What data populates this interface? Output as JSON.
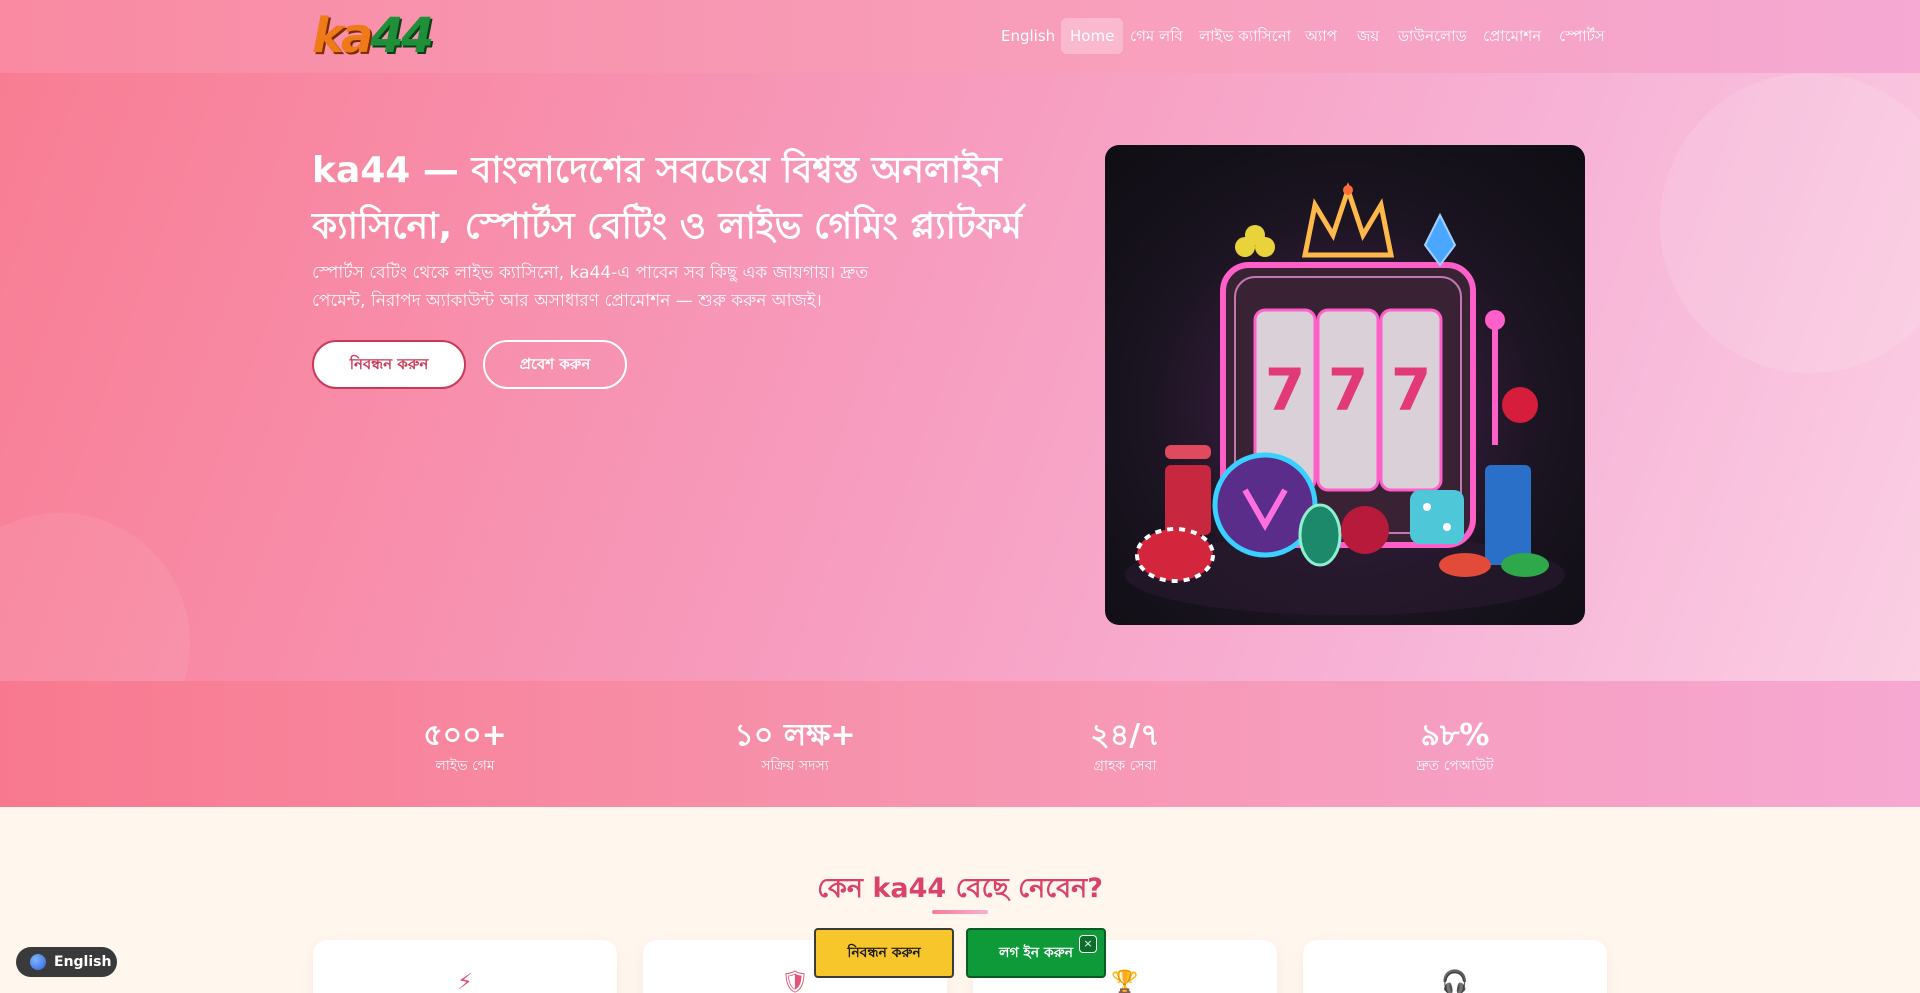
{
  "header": {
    "logo_text_left": "ka",
    "logo_text_right": "44",
    "nav": [
      {
        "label": "English"
      },
      {
        "label": "Home",
        "active": true
      },
      {
        "label": "গেম লবি"
      },
      {
        "label": "লাইভ ক্যাসিনো"
      },
      {
        "label": "অ্যাপ"
      },
      {
        "label": "জয়"
      },
      {
        "label": "ডাউনলোড"
      },
      {
        "label": "প্রোমোশন"
      },
      {
        "label": "স্পোর্টস"
      }
    ]
  },
  "hero": {
    "title": "ka44 — বাংলাদেশের সবচেয়ে বিশ্বস্ত অনলাইন ক্যাসিনো, স্পোর্টস বেটিং ও লাইভ গেমিং প্ল্যাটফর্ম",
    "subtitle": "স্পোর্টস বেটিং থেকে লাইভ ক্যাসিনো, ka44-এ পাবেন সব কিছু এক জায়গায়। দ্রুত পেমেন্ট, নিরাপদ অ্যাকাউন্ট আর অসাধারণ প্রোমোশন — শুরু করুন আজই।",
    "register_button": "নিবন্ধন করুন",
    "login_button": "প্রবেশ করুন",
    "image_icon": "slot-machine-image"
  },
  "stats": [
    {
      "value": "৫০০+",
      "label": "লাইভ গেম"
    },
    {
      "value": "১০ লক্ষ+",
      "label": "সক্রিয় সদস্য"
    },
    {
      "value": "২৪/৭",
      "label": "গ্রাহক সেবা"
    },
    {
      "value": "৯৮%",
      "label": "দ্রুত পেআউট"
    }
  ],
  "why": {
    "title": "কেন ka44 বেছে নেবেন?",
    "cards": [
      {
        "icon": "lightning-icon",
        "glyph": "⚡"
      },
      {
        "icon": "shield-icon",
        "glyph": "🛡"
      },
      {
        "icon": "trophy-icon",
        "glyph": "🏆"
      },
      {
        "icon": "headset-icon",
        "glyph": "🎧"
      }
    ]
  },
  "bottom_bar": {
    "register_label": "নিবন্ধন করুন",
    "login_label": "লগ ইন করুন",
    "close_label": "×"
  },
  "language_switcher": {
    "label": "English"
  },
  "colors": {
    "accent": "#d9426a",
    "register_yellow": "#f6c62a",
    "login_green": "#0f9a3a"
  }
}
